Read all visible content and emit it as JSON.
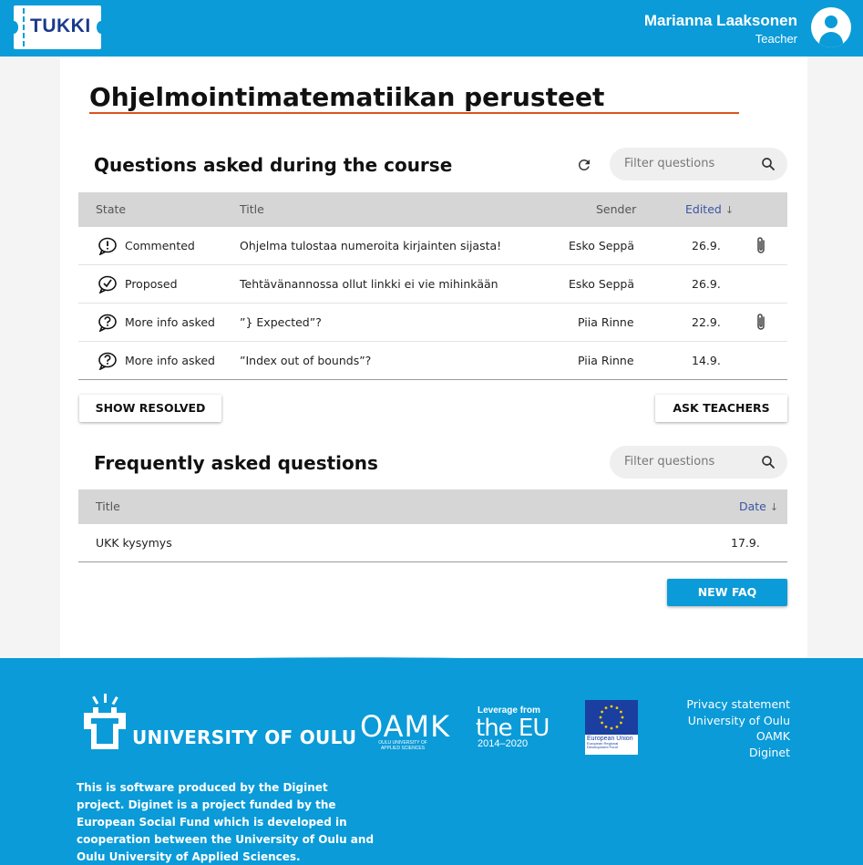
{
  "header": {
    "logo_text": "TUKKI",
    "user_name": "Marianna Laaksonen",
    "user_role": "Teacher"
  },
  "course": {
    "title": "Ohjelmointimatematiikan perusteet"
  },
  "questions": {
    "section_title": "Questions asked during the course",
    "filter_placeholder": "Filter questions",
    "columns": {
      "state": "State",
      "title": "Title",
      "sender": "Sender",
      "edited": "Edited"
    },
    "rows": [
      {
        "state": "Commented",
        "state_icon": "exclamation-bubble-icon",
        "title": "Ohjelma tulostaa numeroita kirjainten sijasta!",
        "sender": "Esko Seppä",
        "edited": "26.9.",
        "attachment": true
      },
      {
        "state": "Proposed",
        "state_icon": "checkmark-bubble-icon",
        "title": "Tehtävänannossa ollut linkki ei vie mihinkään",
        "sender": "Esko Seppä",
        "edited": "26.9.",
        "attachment": false
      },
      {
        "state": "More info asked",
        "state_icon": "question-bubble-icon",
        "title": "”} Expected”?",
        "sender": "Piia Rinne",
        "edited": "22.9.",
        "attachment": true
      },
      {
        "state": "More info asked",
        "state_icon": "question-bubble-icon",
        "title": "”Index out of bounds”?",
        "sender": "Piia Rinne",
        "edited": "14.9.",
        "attachment": false
      }
    ],
    "show_resolved_label": "SHOW RESOLVED",
    "ask_teachers_label": "ASK TEACHERS"
  },
  "faq": {
    "section_title": "Frequently asked questions",
    "filter_placeholder": "Filter questions",
    "columns": {
      "title": "Title",
      "date": "Date"
    },
    "rows": [
      {
        "title": "UKK kysymys",
        "date": "17.9."
      }
    ],
    "new_faq_label": "NEW FAQ"
  },
  "footer": {
    "university_name": "UNIVERSITY OF OULU",
    "oamk": "OAMK",
    "oamk_sub": "OULU UNIVERSITY OF APPLIED SCIENCES",
    "eu_leverage": "Leverage from",
    "eu_big": "the EU",
    "eu_years": "2014–2020",
    "eu_flag_label": "European Union",
    "eu_flag_sub": "European Regional Development Fund",
    "links": [
      "Privacy statement",
      "University of Oulu",
      "OAMK",
      "Diginet"
    ],
    "description": "This is software produced by the Diginet project. Diginet is a project funded by the European Social Fund which is developed in cooperation between the University of Oulu and Oulu University of Applied Sciences."
  },
  "colors": {
    "brand_blue": "#0a9bd8",
    "title_underline": "#d9541e",
    "sort_active": "#3a55a5"
  }
}
